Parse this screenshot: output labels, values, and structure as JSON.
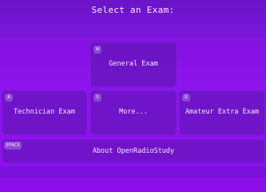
{
  "title": "Select an Exam:",
  "tiles": {
    "general": {
      "key": "W",
      "label": "General Exam"
    },
    "technician": {
      "key": "A",
      "label": "Technician Exam"
    },
    "more": {
      "key": "S",
      "label": "More..."
    },
    "extra": {
      "key": "D",
      "label": "Amateur Extra Exam"
    },
    "about": {
      "key": "SPACE",
      "label": "About OpenRadioStudy"
    }
  },
  "colors": {
    "background": "#8a0fe8",
    "header": "#6a14c8",
    "tile": "#5816aa",
    "text": "#ffffff"
  }
}
